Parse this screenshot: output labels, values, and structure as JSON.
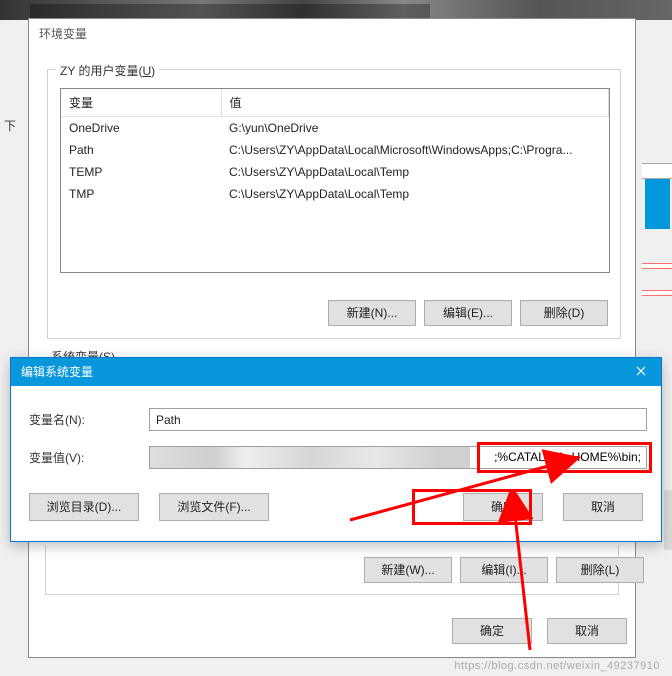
{
  "env_dialog": {
    "title": "环境变量"
  },
  "user_vars": {
    "label": "ZY 的用户变量(",
    "label_u": "U",
    "label_end": ")",
    "headers": {
      "name": "变量",
      "value": "值"
    },
    "rows": [
      {
        "name": "OneDrive",
        "value": "G:\\yun\\OneDrive"
      },
      {
        "name": "Path",
        "value": "C:\\Users\\ZY\\AppData\\Local\\Microsoft\\WindowsApps;C:\\Progra..."
      },
      {
        "name": "TEMP",
        "value": "C:\\Users\\ZY\\AppData\\Local\\Temp"
      },
      {
        "name": "TMP",
        "value": "C:\\Users\\ZY\\AppData\\Local\\Temp"
      }
    ],
    "buttons": {
      "new": "新建(N)...",
      "edit": "编辑(E)...",
      "delete": "删除(D)"
    }
  },
  "sys_vars": {
    "label": "系统变量(",
    "label_u": "S",
    "label_end": ")",
    "buttons": {
      "new": "新建(W)...",
      "edit": "编辑(I)...",
      "delete": "删除(L)"
    }
  },
  "edit_dialog": {
    "title": "编辑系统变量",
    "name_label": "变量名(N):",
    "name_value": "Path",
    "value_label": "变量值(V):",
    "value_visible": ";%CATALINA_HOME%\\bin;",
    "browse_dir": "浏览目录(D)...",
    "browse_file": "浏览文件(F)...",
    "ok": "确定",
    "cancel": "取消"
  },
  "final": {
    "ok": "确定",
    "cancel": "取消"
  },
  "side_char": "下",
  "watermark": "https://blog.csdn.net/weixin_49237910"
}
